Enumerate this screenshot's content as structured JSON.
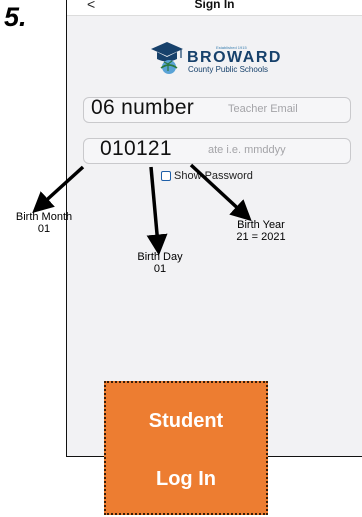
{
  "step_label": "5.",
  "nav": {
    "back_glyph": "<",
    "title": "Sign In"
  },
  "logo": {
    "tagline": "Established 1915",
    "name": "BROWARD",
    "subtitle": "County Public Schools"
  },
  "fields": {
    "username": {
      "placeholder": "Student Number/Teacher Email",
      "visible_placeholder_tail": "Teacher Email",
      "overlay_value": "06 number"
    },
    "password": {
      "placeholder": "Birthdate i.e. mmddyy",
      "visible_placeholder_tail": "ate i.e. mmddyy",
      "overlay_value": "010121"
    }
  },
  "show_password": {
    "label": "Show Password",
    "checked": false
  },
  "annotations": {
    "birth_month": {
      "label": "Birth Month",
      "value": "01"
    },
    "birth_day": {
      "label": "Birth Day",
      "value": "01"
    },
    "birth_year": {
      "label": "Birth Year",
      "value": "21 = 2021"
    }
  },
  "cta": {
    "line1": "Student",
    "line2": "Log In",
    "color": "#ed7d31"
  },
  "icons": {
    "back": "chevron-left-icon",
    "logo": "mortarboard-icon",
    "checkbox": "checkbox-icon"
  }
}
